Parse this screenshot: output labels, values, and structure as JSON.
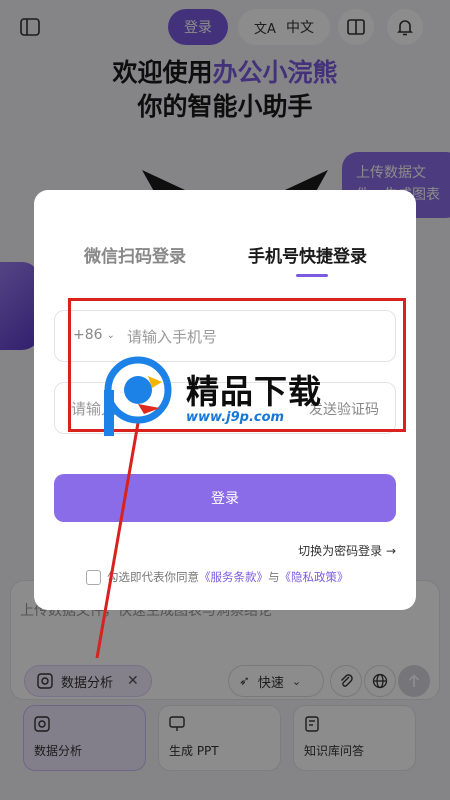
{
  "header": {
    "login_label": "登录",
    "language_label": "中文"
  },
  "hero": {
    "title_prefix": "欢迎使用",
    "brand_name": "办公小浣熊",
    "subtitle": "你的智能小助手"
  },
  "upload_bubble_text": "上传数据文件，生成图表",
  "composer": {
    "placeholder": "上传数据文件，快速生成图表与洞察结论",
    "chip_label": "数据分析",
    "speed_label": "快速"
  },
  "tool_cards": [
    {
      "label": "数据分析",
      "icon": "data-analysis-icon"
    },
    {
      "label": "生成 PPT",
      "icon": "ppt-icon"
    },
    {
      "label": "知识库问答",
      "icon": "knowledge-icon"
    }
  ],
  "login_modal": {
    "tabs": [
      {
        "label": "微信扫码登录",
        "active": false
      },
      {
        "label": "手机号快捷登录",
        "active": true
      }
    ],
    "phone_prefix": "+86",
    "phone_placeholder": "请输入手机号",
    "code_placeholder": "请输入验证码",
    "send_code_label": "发送验证码",
    "login_button": "登录",
    "switch_password_label": "切换为密码登录 →",
    "agreement_prefix": "勾选即代表你同意",
    "terms_link": "《服务条款》",
    "agreement_and": "与",
    "privacy_link": "《隐私政策》"
  },
  "watermark": {
    "title": "精品下载",
    "url": "www.j9p.com"
  },
  "colors": {
    "accent": "#7b5ce0",
    "button": "#8b6ce8",
    "annotation_red": "#d9211e"
  }
}
